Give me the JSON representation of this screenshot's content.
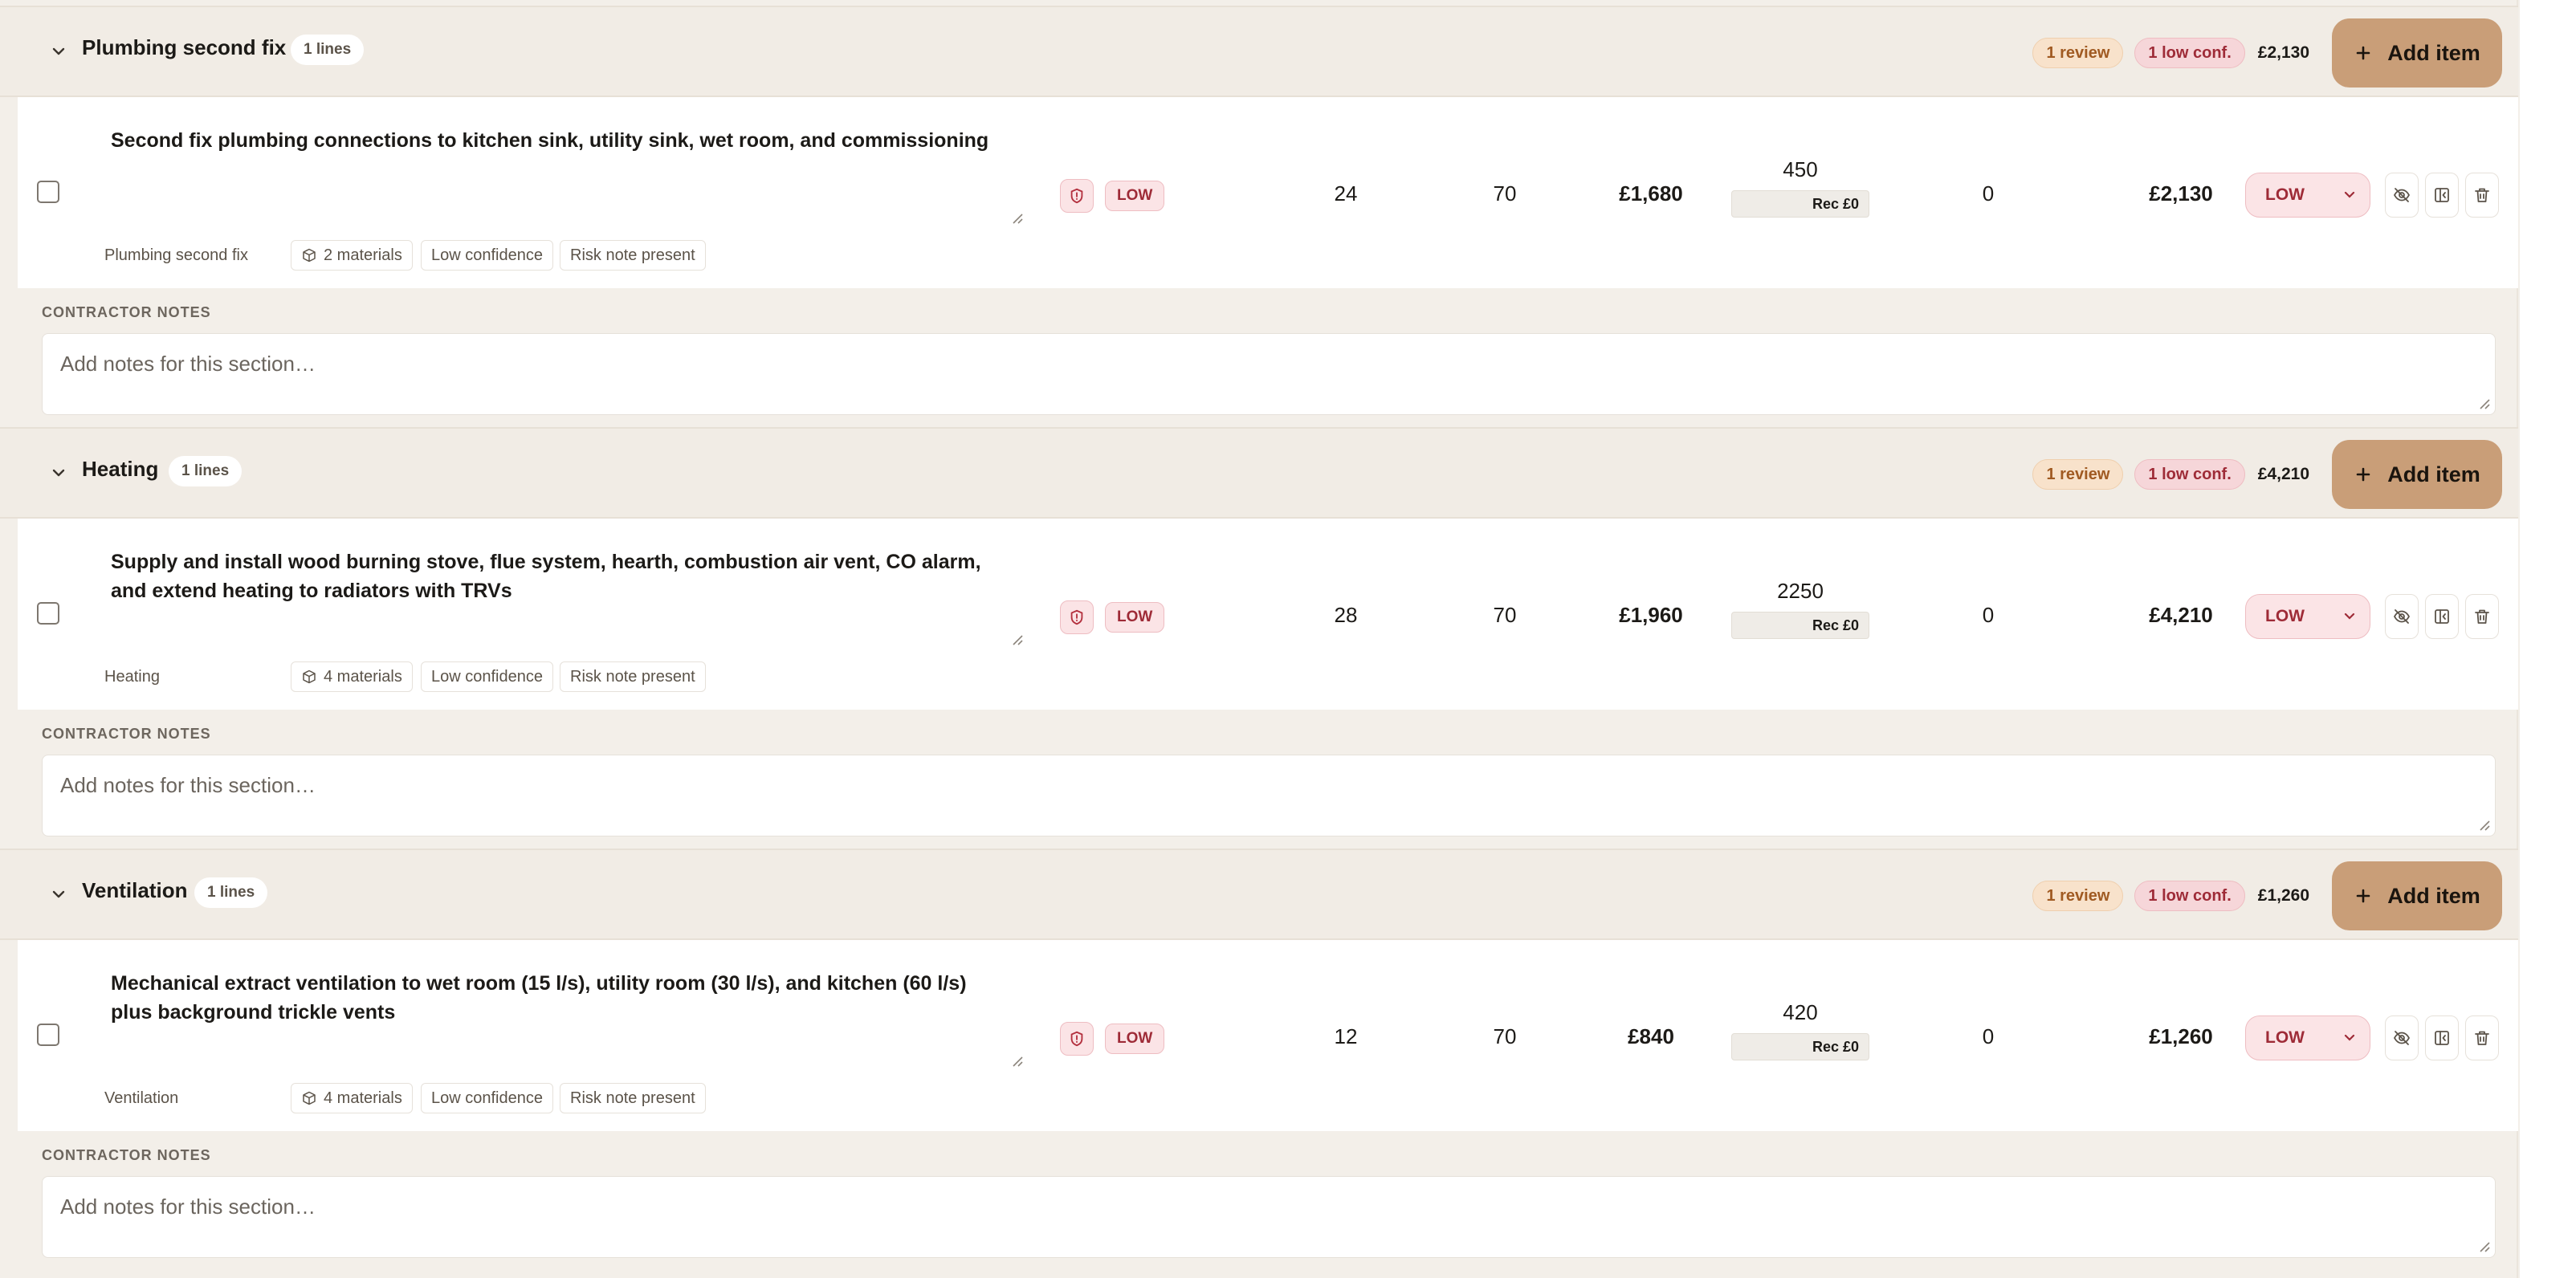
{
  "sections": [
    {
      "title": "Plumbing second fix",
      "lines": "1 lines",
      "review": "1 review",
      "low_conf": "1 low conf.",
      "total": "£2,130",
      "add_label": "Add item",
      "row": {
        "description": "Second fix plumbing connections to kitchen sink, utility sink, wet room, and commissioning",
        "risk": "LOW",
        "qty": "24",
        "rate": "70",
        "labour": "£1,680",
        "materials": "450",
        "rec": "Rec £0",
        "extra": "0",
        "total": "£2,130",
        "confidence": "LOW",
        "category": "Plumbing second fix",
        "materials_tag": "2 materials",
        "tag_low": "Low confidence",
        "tag_risk": "Risk note present"
      },
      "notes_label": "CONTRACTOR NOTES",
      "notes_placeholder": "Add notes for this section…"
    },
    {
      "title": "Heating",
      "lines": "1 lines",
      "review": "1 review",
      "low_conf": "1 low conf.",
      "total": "£4,210",
      "add_label": "Add item",
      "row": {
        "description": "Supply and install wood burning stove, flue system, hearth, combustion air vent, CO alarm,\nand extend heating to radiators with TRVs",
        "risk": "LOW",
        "qty": "28",
        "rate": "70",
        "labour": "£1,960",
        "materials": "2250",
        "rec": "Rec £0",
        "extra": "0",
        "total": "£4,210",
        "confidence": "LOW",
        "category": "Heating",
        "materials_tag": "4 materials",
        "tag_low": "Low confidence",
        "tag_risk": "Risk note present"
      },
      "notes_label": "CONTRACTOR NOTES",
      "notes_placeholder": "Add notes for this section…"
    },
    {
      "title": "Ventilation",
      "lines": "1 lines",
      "review": "1 review",
      "low_conf": "1 low conf.",
      "total": "£1,260",
      "add_label": "Add item",
      "row": {
        "description": "Mechanical extract ventilation to wet room (15 l/s), utility room (30 l/s), and kitchen (60 l/s)\nplus background trickle vents",
        "risk": "LOW",
        "qty": "12",
        "rate": "70",
        "labour": "£840",
        "materials": "420",
        "rec": "Rec £0",
        "extra": "0",
        "total": "£1,260",
        "confidence": "LOW",
        "category": "Ventilation",
        "materials_tag": "4 materials",
        "tag_low": "Low confidence",
        "tag_risk": "Risk note present"
      },
      "notes_label": "CONTRACTOR NOTES",
      "notes_placeholder": "Add notes for this section…"
    }
  ],
  "icons": {
    "collapse": "chevron-down-icon",
    "add": "plus-icon",
    "risk": "shield-alert-icon",
    "hide": "eye-off-icon",
    "split": "panel-icon",
    "delete": "trash-icon",
    "materials": "box-icon"
  },
  "colors": {
    "accent": "#c99e78",
    "review_bg": "#f8e2cb",
    "low_bg": "#f6d6d9",
    "low_text": "#9e2b37",
    "page_bg": "#f3efe9"
  }
}
